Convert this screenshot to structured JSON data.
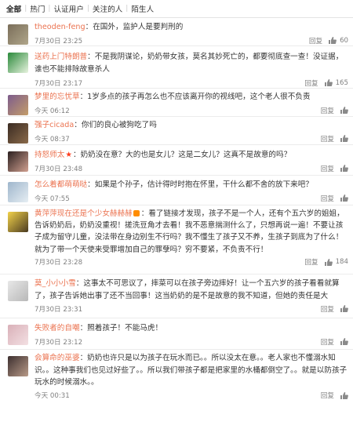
{
  "tabs": [
    "全部",
    "热门",
    "认证用户",
    "关注的人",
    "陌生人"
  ],
  "actions": {
    "reply": "回复"
  },
  "comments": [
    {
      "user": "theoden-feng",
      "text": "：在国外，监护人是要判刑的",
      "time": "7月30日 23:25",
      "likes": "60",
      "colors": [
        "#7a6e5a",
        "#b0a68a"
      ]
    },
    {
      "user": "送药上门特朗普",
      "text": "：不是我阴谋论，奶奶带女孩，莫名其妙死亡的，都要彻底查一查！没证据，谁也不能排除故意杀人",
      "time": "7月30日 23:17",
      "likes": "165",
      "colors": [
        "#2a8a3a",
        "#e8f3df"
      ]
    },
    {
      "user": "梦里的忘忧草",
      "text": "：1岁多点的孩子再怎么也不应该离开你的视线吧，这个老人很不负责",
      "time": "今天 06:12",
      "likes": "",
      "colors": [
        "#7d5c8c",
        "#c49d6a"
      ]
    },
    {
      "user": "强子cicada",
      "text": "：你们的良心被狗吃了吗",
      "time": "今天 08:37",
      "likes": "",
      "colors": [
        "#3a2b22",
        "#8a6a4a"
      ]
    },
    {
      "user": "持怒师太",
      "text": "：奶奶没在意？大的也是女儿？这是二女儿？这真不是故意的吗？",
      "time": "7月30日 23:48",
      "likes": "",
      "colors": [
        "#2b2020",
        "#d1a090"
      ]
    },
    {
      "user": "怎么着都萌萌哒",
      "text": "：如果是个孙子，估计得时时抱在怀里，干什么都不舍的放下来吧？",
      "time": "今天 07:55",
      "likes": "",
      "colors": [
        "#9fb6cc",
        "#e6eef3"
      ]
    },
    {
      "user": "黄萍萍现在还是个少女赫赫赫",
      "text": "：看了链接才发现，孩子不是一个人，还有个五六岁的姐姐，告诉奶奶后，奶奶没重视！搓洗豆角才去看！我不恶意揣测什么了，只想再说一遍！不要让孩子成为留守儿童，没法带在身边别生不行吗？我不懂生了孩子又不养，生孩子到底为了什么！就为了带一个天使来受罪增加自己的罪孽吗？穷不要紧，不负责不行！",
      "time": "7月30日 23:28",
      "likes": "184",
      "colors": [
        "#f2d24a",
        "#4a3a20"
      ]
    },
    {
      "user": "莫_小小小雪",
      "text": "：这事太不可思议了，摔菜可以在孩子旁边摔好！让一个五六岁的孩子看看就算了，孩子告诉她出事了还不当回事！这当奶奶的是不是故意的我不知道，但她的责任是大",
      "time": "7月30日 23:31",
      "likes": "",
      "colors": [
        "#e8e8e8",
        "#b8b8b8"
      ]
    },
    {
      "user": "失败者的自嘲",
      "text": "：照着孩子！不能马虎！",
      "time": "7月30日 23:12",
      "likes": "",
      "colors": [
        "#d9b0b8",
        "#f3e0e3"
      ]
    },
    {
      "user": "会算命的巫婆",
      "text": "：奶奶也许只是以为孩子在玩水而已。。所以没太在意。。老人家也不懂溺水知识。。这种事我们也见过好些了。。所以我们带孩子都是把家里的水桶都倒空了。。就是以防孩子玩水的时候溺水。。",
      "time": "今天 00:31",
      "likes": "",
      "colors": [
        "#3d3030",
        "#b89a88"
      ]
    }
  ]
}
